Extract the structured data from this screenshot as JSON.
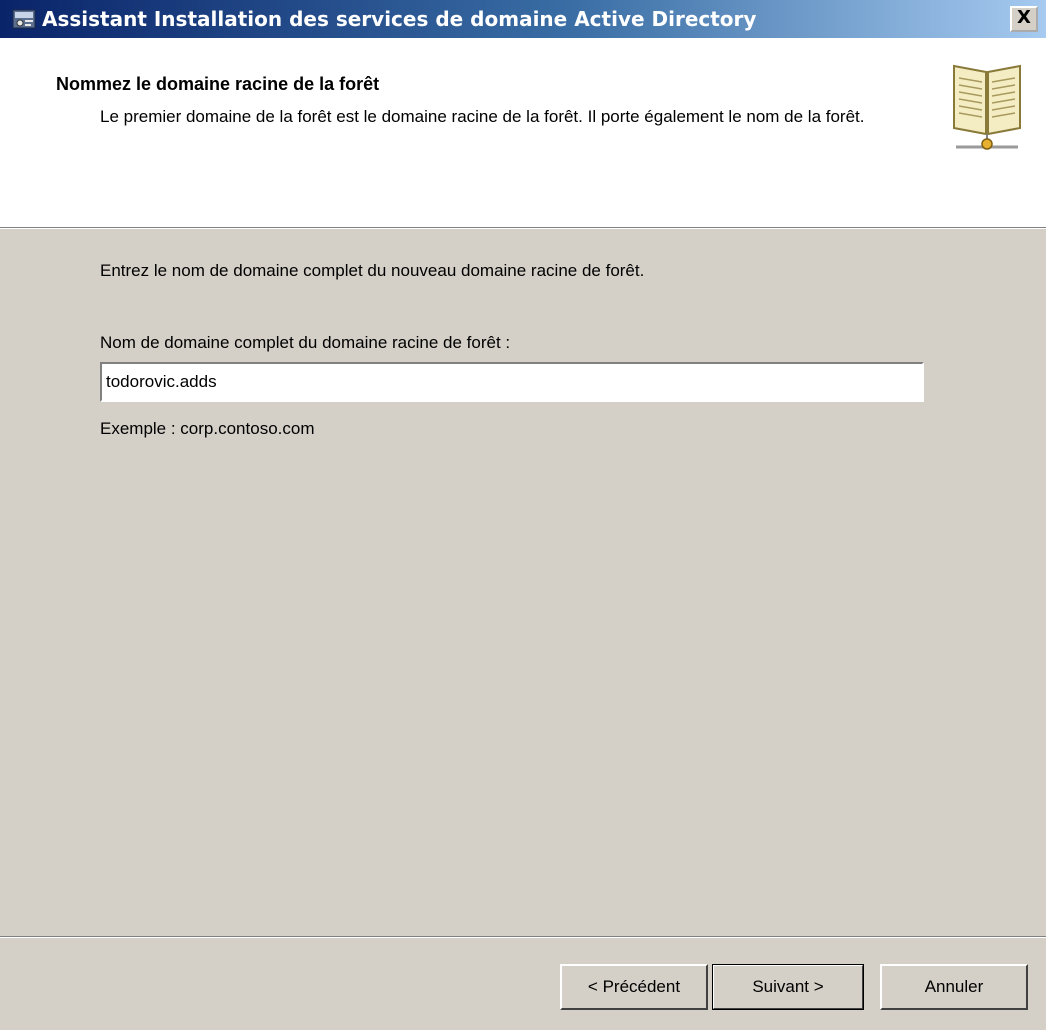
{
  "window": {
    "title": "Assistant Installation des services de domaine Active Directory",
    "close_label": "X",
    "icon": "ad-wizard-icon"
  },
  "header": {
    "title": "Nommez le domaine racine de la forêt",
    "description": "Le premier domaine de la forêt est le domaine racine de la forêt. Il porte également le nom de la forêt.",
    "icon": "directory-book-icon"
  },
  "main": {
    "intro": "Entrez le nom de domaine complet du nouveau domaine racine de forêt.",
    "fqdn_label": "Nom de domaine complet du domaine racine de forêt :",
    "fqdn_value": "todorovic.adds",
    "example": "Exemple : corp.contoso.com"
  },
  "buttons": {
    "back": "< Précédent",
    "next": "Suivant >",
    "cancel": "Annuler"
  },
  "colors": {
    "titlebar_start": "#0a246a",
    "titlebar_end": "#a6caf0",
    "dialog_bg": "#d4d0c8",
    "header_bg": "#ffffff"
  }
}
